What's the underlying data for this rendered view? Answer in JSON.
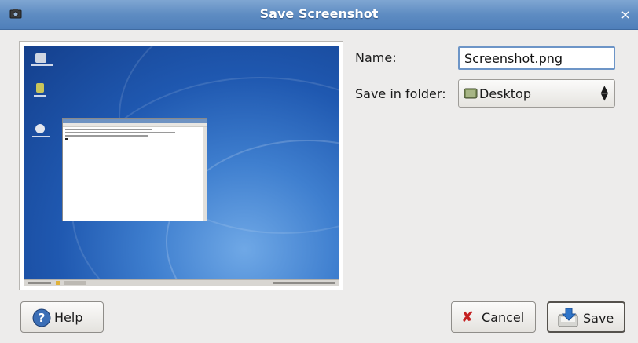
{
  "window": {
    "title": "Save Screenshot",
    "close_glyph": "×",
    "icon": "camera-icon"
  },
  "form": {
    "name_label": "Name:",
    "name_value": "Screenshot.png",
    "folder_label": "Save in folder:",
    "folder_value": "Desktop",
    "folder_icon": "desktop-folder-icon"
  },
  "buttons": {
    "help": "Help",
    "cancel": "Cancel",
    "save": "Save",
    "help_icon": "help-icon",
    "cancel_icon": "cancel-icon",
    "save_icon": "save-icon"
  },
  "colors": {
    "titlebar": "#5e8cc2",
    "desktop_bg": "#1f58b0"
  }
}
